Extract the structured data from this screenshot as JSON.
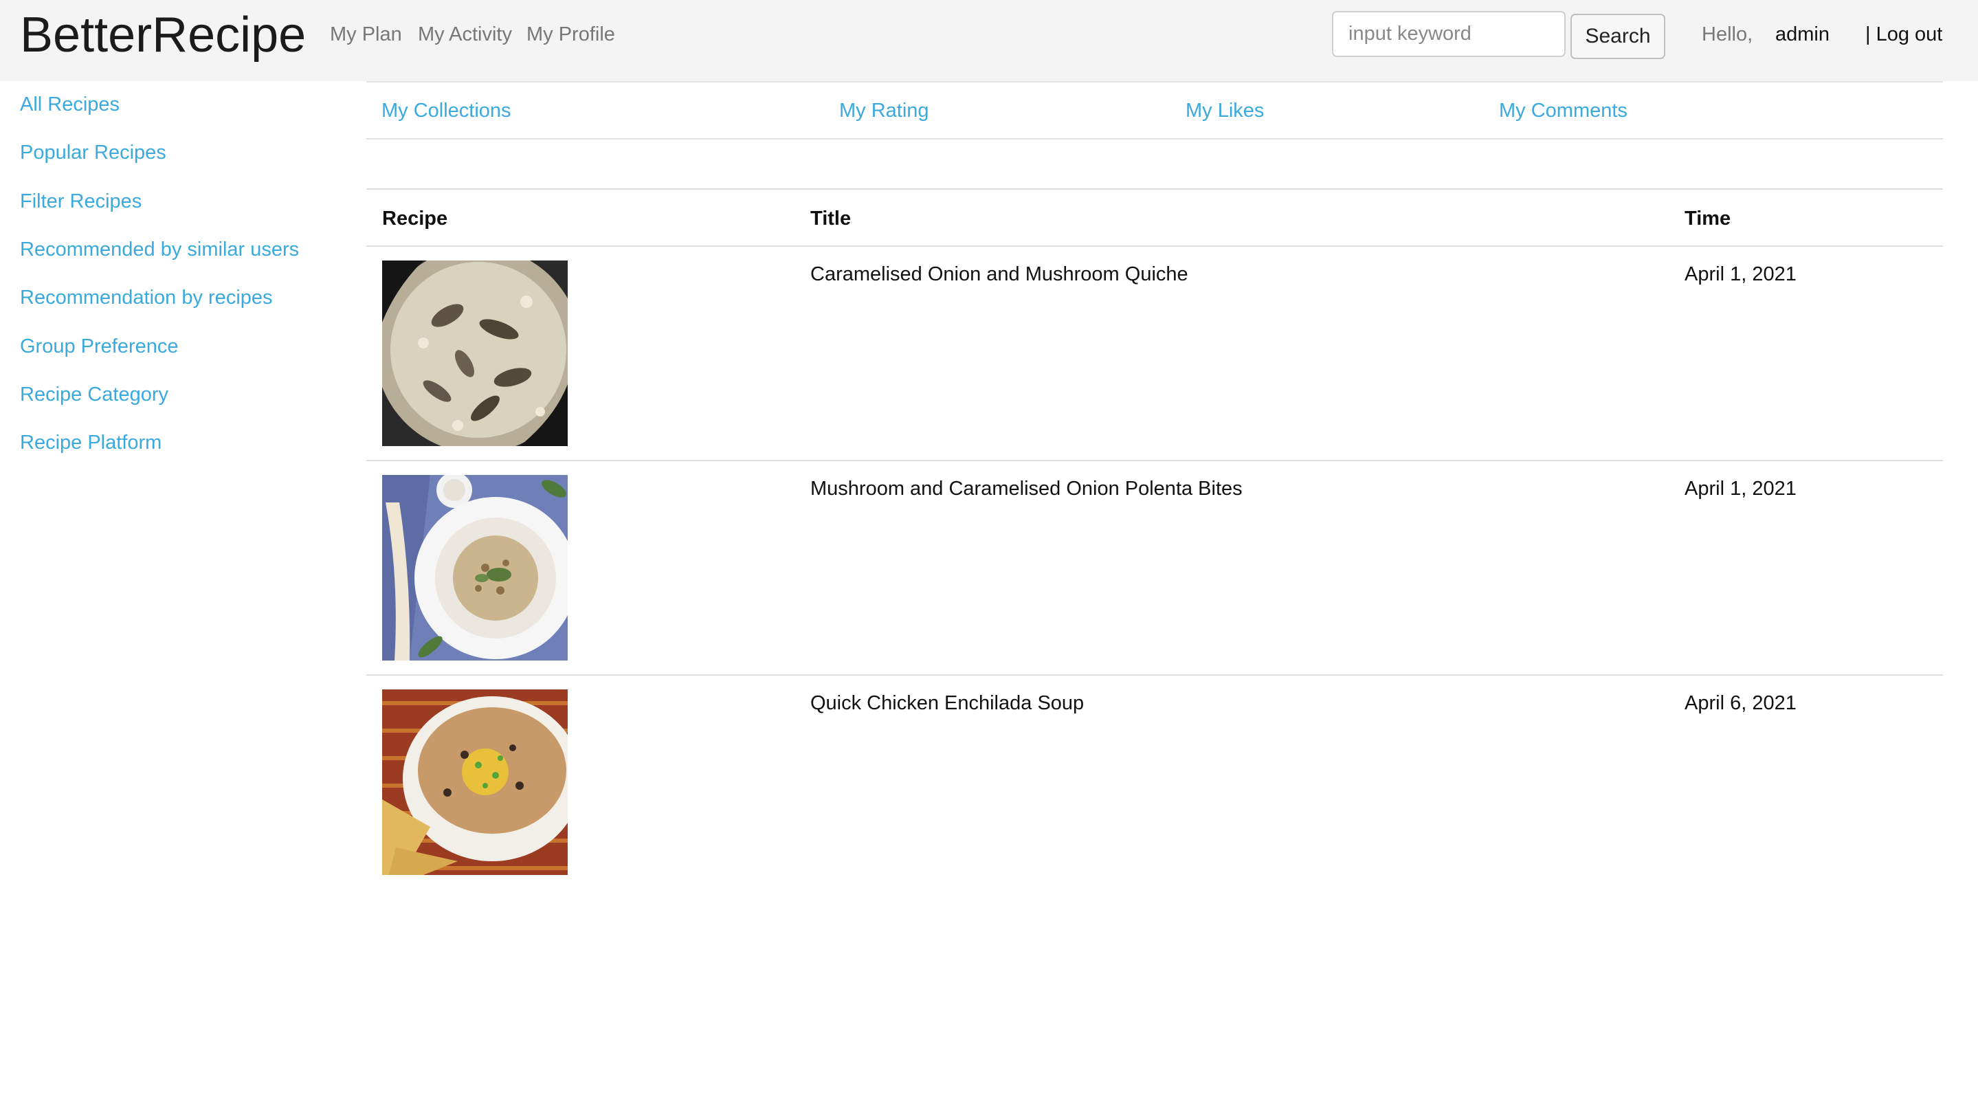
{
  "header": {
    "brand": "BetterRecipe",
    "nav": [
      "My Plan",
      "My Activity",
      "My Profile"
    ],
    "search": {
      "placeholder": "input keyword",
      "value": "",
      "button_label": "Search"
    },
    "greeting": "Hello,",
    "username": "admin",
    "logout_label": "| Log out"
  },
  "sidebar": {
    "items": [
      "All Recipes",
      "Popular Recipes",
      "Filter Recipes",
      "Recommended by similar users",
      "Recommendation by recipes",
      "Group Preference",
      "Recipe Category",
      "Recipe Platform"
    ]
  },
  "tabs": [
    "My Collections",
    "My Rating",
    "My Likes",
    "My Comments"
  ],
  "table": {
    "headers": {
      "recipe": "Recipe",
      "title": "Title",
      "time": "Time"
    },
    "rows": [
      {
        "image": "quiche-image",
        "title": "Caramelised Onion and Mushroom Quiche",
        "time": "April 1, 2021"
      },
      {
        "image": "polenta-bites-image",
        "title": "Mushroom and Caramelised Onion Polenta Bites",
        "time": "April 1, 2021"
      },
      {
        "image": "enchilada-soup-image",
        "title": "Quick Chicken Enchilada Soup",
        "time": "April 6, 2021"
      }
    ]
  },
  "colors": {
    "link": "#3aa9de",
    "navbar_bg": "#f4f4f4",
    "border": "#dedede"
  }
}
